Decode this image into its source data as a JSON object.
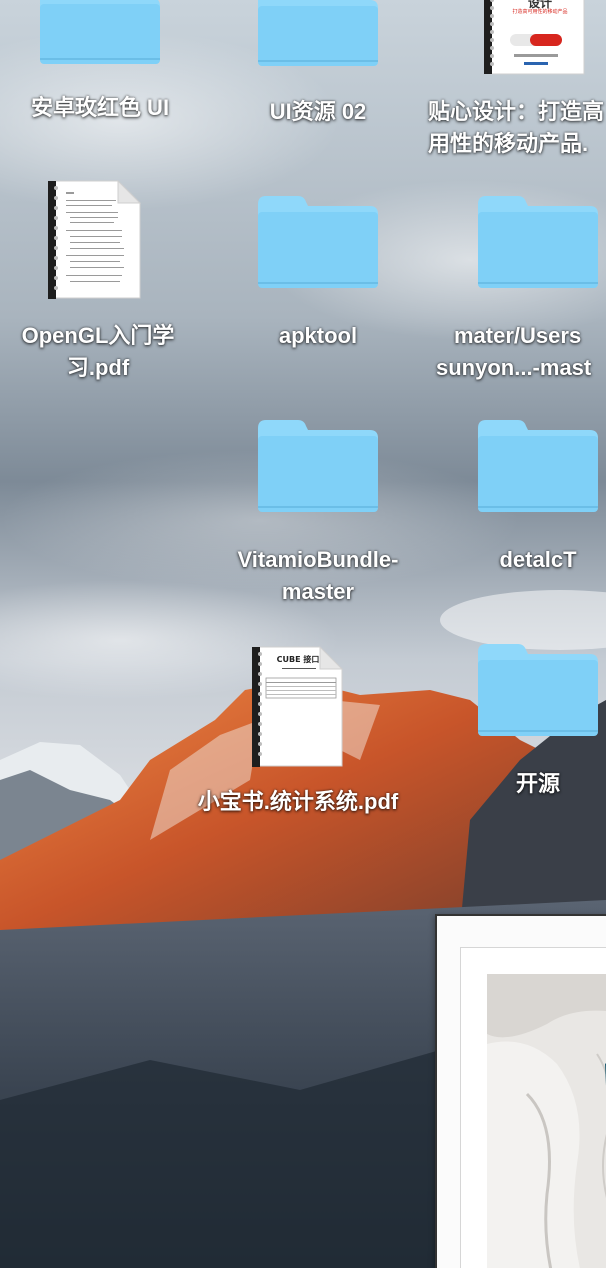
{
  "desktop": {
    "icons": [
      {
        "type": "folder",
        "line1": "安卓玫红色 UI",
        "line2": ""
      },
      {
        "type": "folder",
        "line1": "UI资源 02",
        "line2": ""
      },
      {
        "type": "document",
        "line1": "贴心设计：打造高",
        "line2": "用性的移动产品.",
        "cover_title": "设计",
        "cover_subtitle": "打造高可用性的移动产品"
      },
      {
        "type": "document",
        "line1": "OpenGL入门学",
        "line2": "习.pdf"
      },
      {
        "type": "folder",
        "line1": "apktool",
        "line2": ""
      },
      {
        "type": "folder",
        "line1": "mater/Users",
        "line2": "sunyon...-mast"
      },
      {
        "type": "folder",
        "line1": "VitamioBundle-",
        "line2": "master"
      },
      {
        "type": "folder",
        "line1": "detalcT",
        "line2": ""
      },
      {
        "type": "document",
        "line1": "小宝书.统计系统.pdf",
        "line2": "",
        "cover_title": "CUBE 接口"
      },
      {
        "type": "folder",
        "line1": "开源",
        "line2": ""
      }
    ]
  },
  "colors": {
    "folder_body": "#7fd0f7",
    "folder_tab": "#8fd8fa",
    "label_text": "#ffffff",
    "sky": "#b8c4cf",
    "cliff_glow": "#e0733a"
  },
  "icon_names": {
    "folder": "folder-icon",
    "document": "pdf-document-icon"
  }
}
